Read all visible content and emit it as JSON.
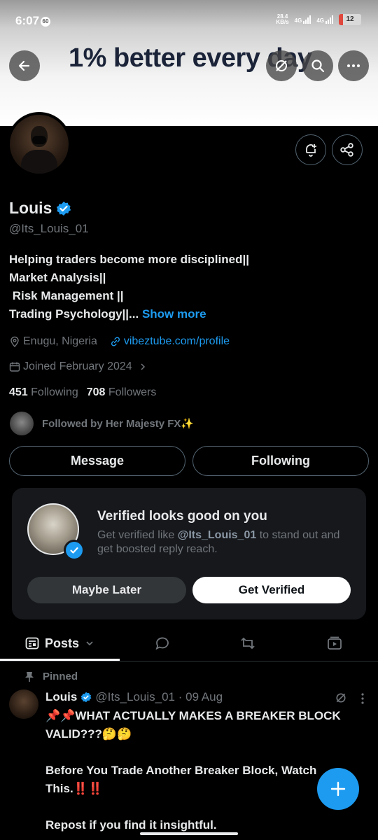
{
  "status": {
    "time": "6:07",
    "badge": "60",
    "speed": "28.4\nKB/s",
    "net1": "4G",
    "net2": "4G",
    "battery": "12"
  },
  "banner": {
    "text": "1% better every day"
  },
  "profile": {
    "name": "Louis",
    "handle": "@Its_Louis_01",
    "bio_lines": [
      "Helping traders become more disciplined||",
      "Market Analysis||",
      " Risk Management ||",
      "Trading Psychology||..."
    ],
    "show_more": "Show more",
    "location": "Enugu, Nigeria",
    "website": "vibeztube.com/profile",
    "joined": "Joined February 2024",
    "following_count": "451",
    "following_label": "Following",
    "followers_count": "708",
    "followers_label": "Followers",
    "followed_by": "Followed by Her Majesty FX✨"
  },
  "actions": {
    "message": "Message",
    "following": "Following"
  },
  "verified_card": {
    "title": "Verified looks good on you",
    "desc_prefix": "Get verified like ",
    "desc_handle": "@Its_Louis_01",
    "desc_suffix": " to stand out and get boosted reply reach.",
    "later": "Maybe Later",
    "get": "Get Verified"
  },
  "tabs": {
    "posts": "Posts"
  },
  "post": {
    "pinned": "Pinned",
    "author": "Louis",
    "handle_date": "@Its_Louis_01 · 09 Aug",
    "line1": "📌📌WHAT ACTUALLY MAKES A BREAKER BLOCK VALID???🤔🤔",
    "line2": "Before You Trade Another Breaker Block, Watch This.‼️‼️",
    "line3": "Repost if you find it insightful."
  },
  "colors": {
    "accent": "#1d9bf0",
    "background": "#000000",
    "muted": "#71767b"
  }
}
